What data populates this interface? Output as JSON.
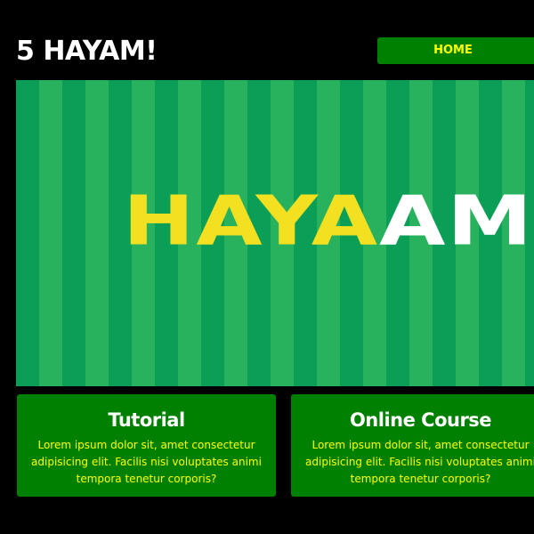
{
  "header": {
    "site_title": "5 HAYAM!"
  },
  "nav": {
    "items": [
      {
        "label": "HOME"
      }
    ]
  },
  "hero": {
    "wordmark_part1": "HAYA",
    "wordmark_part2": "AM",
    "colors": {
      "stripe_dark": "#0a9e56",
      "stripe_light": "#28b25e",
      "wordmark_yellow": "#f2e021",
      "wordmark_white": "#ffffff"
    }
  },
  "cards": [
    {
      "title": "Tutorial",
      "text": "Lorem ipsum dolor sit, amet consectetur adipisicing elit. Facilis nisi voluptates animi tempora tenetur corporis?"
    },
    {
      "title": "Online Course",
      "text": "Lorem ipsum dolor sit, amet consectetur adipisicing elit. Facilis nisi voluptates animi tempora tenetur corporis?"
    }
  ],
  "theme": {
    "background": "#000000",
    "accent_green": "#008000",
    "accent_yellow": "#ffff00",
    "text_white": "#ffffff"
  }
}
